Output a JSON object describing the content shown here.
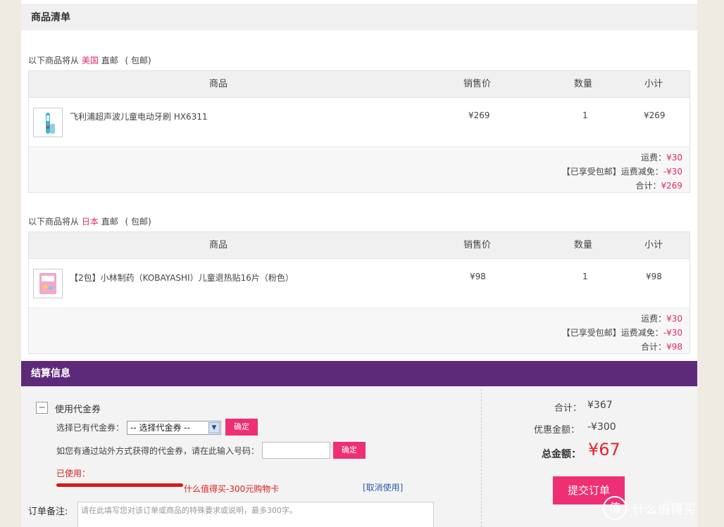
{
  "goods_section": {
    "title": "商品清单"
  },
  "shipments": [
    {
      "prefix": "以下商品将从",
      "country": "美国",
      "suffix": "直邮",
      "note": "( 包邮)",
      "headers": {
        "product": "商品",
        "price": "销售价",
        "qty": "数量",
        "subtotal": "小计"
      },
      "item": {
        "name": "飞利浦超声波儿童电动牙刷 HX6311",
        "price": "¥269",
        "qty": "1",
        "subtotal": "¥269"
      },
      "summary": {
        "shipping_label": "运费：",
        "shipping_value": "¥30",
        "discount_label": "【已享受包邮】运费减免：",
        "discount_value": "-¥30",
        "total_label": "合计：",
        "total_value": "¥269"
      }
    },
    {
      "prefix": "以下商品将从",
      "country": "日本",
      "suffix": "直邮",
      "note": "( 包邮)",
      "headers": {
        "product": "商品",
        "price": "销售价",
        "qty": "数量",
        "subtotal": "小计"
      },
      "item": {
        "name": "【2包】小林制药（KOBAYASHI）儿童退热贴16片（粉色）",
        "price": "¥98",
        "qty": "1",
        "subtotal": "¥98"
      },
      "summary": {
        "shipping_label": "运费：",
        "shipping_value": "¥30",
        "discount_label": "【已享受包邮】运费减免：",
        "discount_value": "-¥30",
        "total_label": "合计：",
        "total_value": "¥98"
      }
    }
  ],
  "settlement": {
    "title": "结算信息",
    "voucher_toggle_symbol": "−",
    "voucher_label": "使用代金券",
    "select_label": "选择已有代金券：",
    "select_value": "-- 选择代金券 --",
    "confirm_label": "确定",
    "code_label": "如您有通过站外方式获得的代金券，请在此输入号码：",
    "used_label": "已使用：",
    "used_voucher_text": "什么值得买-300元购物卡",
    "cancel_use": "[取消使用]",
    "remark_label": "订单备注:",
    "remark_placeholder": "请在此填写您对该订单或商品的特殊要求或说明，最多300字。",
    "subtotal_label": "合计：",
    "subtotal_value": "¥367",
    "discount_label": "优惠金额：",
    "discount_value": "-¥300",
    "grand_total_label": "总金额：",
    "grand_total_value": "¥67",
    "submit_label": "提交订单"
  },
  "watermark": {
    "logo_glyph": "值",
    "text": "什么值得买"
  },
  "colors": {
    "accent_pink": "#ee2f74",
    "price_red": "#e0286e",
    "header_purple": "#5d2a7a"
  }
}
